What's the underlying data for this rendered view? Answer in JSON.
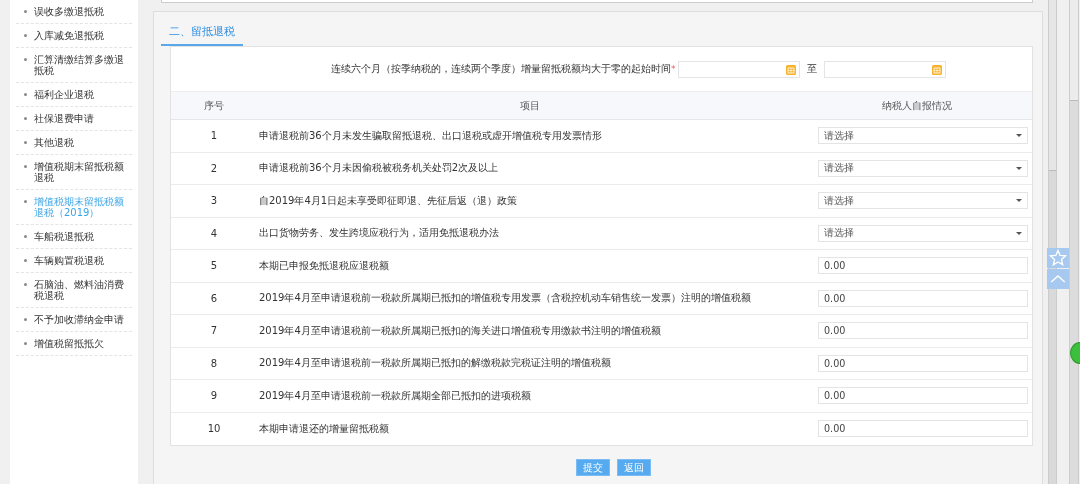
{
  "sidebar": {
    "items": [
      {
        "label": "误收多缴退抵税",
        "selected": false
      },
      {
        "label": "入库减免退抵税",
        "selected": false
      },
      {
        "label": "汇算清缴结算多缴退抵税",
        "selected": false
      },
      {
        "label": "福利企业退税",
        "selected": false
      },
      {
        "label": "社保退费申请",
        "selected": false
      },
      {
        "label": "其他退税",
        "selected": false
      },
      {
        "label": "增值税期末留抵税额退税",
        "selected": false
      },
      {
        "label": "增值税期末留抵税额退税（2019）",
        "selected": true
      },
      {
        "label": "车船税退抵税",
        "selected": false
      },
      {
        "label": "车辆购置税退税",
        "selected": false
      },
      {
        "label": "石脑油、燃料油消费税退税",
        "selected": false
      },
      {
        "label": "不予加收滞纳金申请",
        "selected": false
      },
      {
        "label": "增值税留抵抵欠",
        "selected": false
      }
    ]
  },
  "section": {
    "tab": {
      "label": "二、留抵退税",
      "selected": true
    },
    "date_range": {
      "label": "连续六个月（按季纳税的，连续两个季度）增量留抵税额均大于零的起始时间",
      "required_mark": "*",
      "separator": "至"
    },
    "table": {
      "columns": [
        "序号",
        "项目",
        "纳税人自报情况"
      ],
      "rows": [
        {
          "index": "1",
          "item": "申请退税前36个月未发生骗取留抵退税、出口退税或虚开增值税专用发票情形",
          "kind": "select",
          "value": "请选择"
        },
        {
          "index": "2",
          "item": "申请退税前36个月未因偷税被税务机关处罚2次及以上",
          "kind": "select",
          "value": "请选择"
        },
        {
          "index": "3",
          "item": "自2019年4月1日起未享受即征即退、先征后返（退）政策",
          "kind": "select",
          "value": "请选择"
        },
        {
          "index": "4",
          "item": "出口货物劳务、发生跨境应税行为，适用免抵退税办法",
          "kind": "select",
          "value": "请选择"
        },
        {
          "index": "5",
          "item": "本期已申报免抵退税应退税额",
          "kind": "input",
          "value": "0.00"
        },
        {
          "index": "6",
          "item": "2019年4月至申请退税前一税款所属期已抵扣的增值税专用发票（含税控机动车销售统一发票）注明的增值税额",
          "kind": "input",
          "value": "0.00"
        },
        {
          "index": "7",
          "item": "2019年4月至申请退税前一税款所属期已抵扣的海关进口增值税专用缴款书注明的增值税额",
          "kind": "input",
          "value": "0.00"
        },
        {
          "index": "8",
          "item": "2019年4月至申请退税前一税款所属期已抵扣的解缴税款完税证注明的增值税额",
          "kind": "input",
          "value": "0.00"
        },
        {
          "index": "9",
          "item": "2019年4月至申请退税前一税款所属期全部已抵扣的进项税额",
          "kind": "input",
          "value": "0.00"
        },
        {
          "index": "10",
          "item": "本期申请退还的增量留抵税额",
          "kind": "input",
          "value": "0.00"
        }
      ]
    }
  },
  "buttons": [
    "提交",
    "返回"
  ]
}
